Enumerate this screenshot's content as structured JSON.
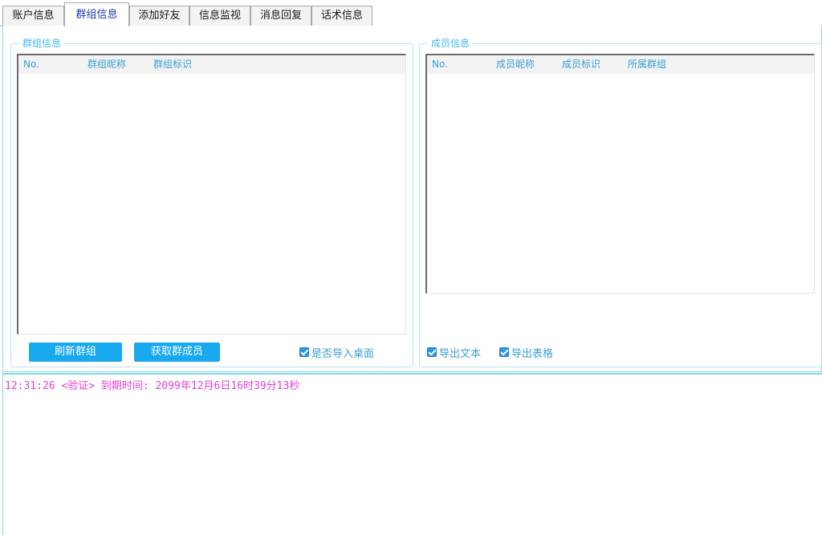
{
  "tabs": [
    {
      "label": "账户信息",
      "active": false
    },
    {
      "label": "群组信息",
      "active": true
    },
    {
      "label": "添加好友",
      "active": false
    },
    {
      "label": "信息监视",
      "active": false
    },
    {
      "label": "消息回复",
      "active": false
    },
    {
      "label": "话术信息",
      "active": false
    }
  ],
  "group_panel": {
    "title": "群组信息",
    "columns": [
      "No.",
      "群组昵称",
      "群组标识"
    ],
    "rows": [],
    "refresh_button": "刷新群组",
    "fetch_members_button": "获取群成员",
    "import_desktop_checkbox": {
      "label": "是否导入桌面",
      "checked": true
    }
  },
  "member_panel": {
    "title": "成员信息",
    "columns": [
      "No.",
      "成员昵称",
      "成员标识",
      "所属群组"
    ],
    "rows": [],
    "export_text_checkbox": {
      "label": "导出文本",
      "checked": true
    },
    "export_table_checkbox": {
      "label": "导出表格",
      "checked": true
    }
  },
  "log": {
    "lines": [
      "12:31:26 <验证> 到期时间: 2099年12月6日16时39分13秒"
    ]
  },
  "colors": {
    "accent": "#18a9ef",
    "panel_border": "#7fd6ec",
    "log_text": "#e23fd2"
  }
}
